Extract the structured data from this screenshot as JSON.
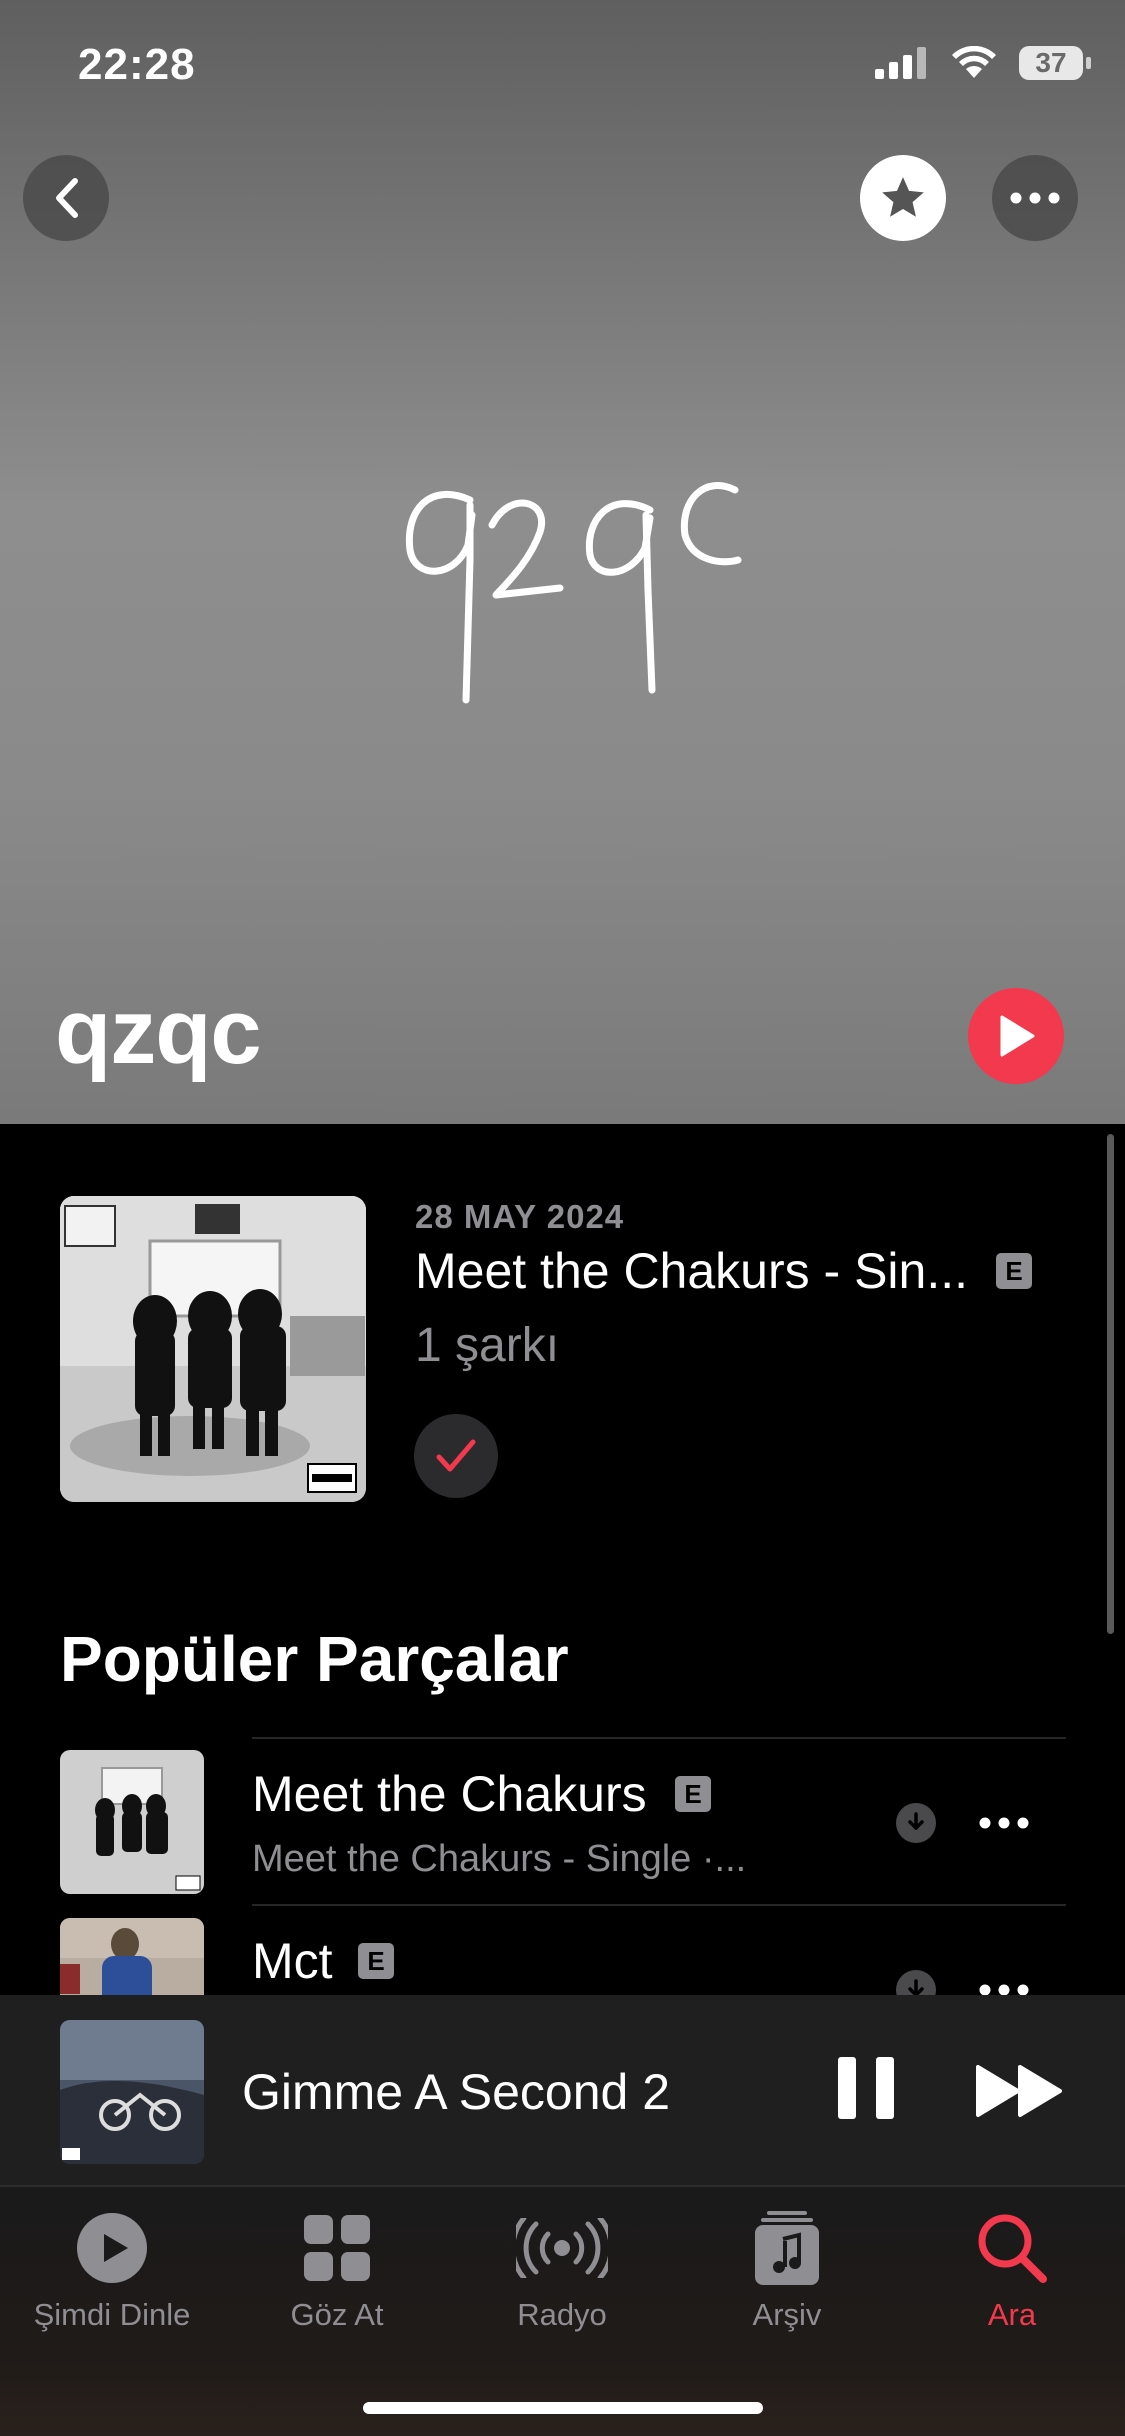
{
  "status_bar": {
    "time": "22:28",
    "battery": "37"
  },
  "artist": {
    "name": "qzqc",
    "logo_text": "qzqc"
  },
  "latest_release": {
    "date": "28 MAY 2024",
    "title": "Meet the Chakurs - Sin...",
    "explicit": "E",
    "count": "1 şarkı"
  },
  "popular": {
    "title": "Popüler Parçalar",
    "tracks": [
      {
        "title": "Meet the Chakurs",
        "explicit": "E",
        "subtitle": "Meet the Chakurs - Single ·..."
      },
      {
        "title": "Mct",
        "explicit": "E",
        "subtitle": ""
      }
    ]
  },
  "now_playing": {
    "title": "Gimme A Second 2"
  },
  "tabs": [
    {
      "label": "Şimdi Dinle",
      "icon": "play-circle-icon"
    },
    {
      "label": "Göz At",
      "icon": "grid-icon"
    },
    {
      "label": "Radyo",
      "icon": "radio-icon"
    },
    {
      "label": "Arşiv",
      "icon": "library-icon"
    },
    {
      "label": "Ara",
      "icon": "search-icon"
    }
  ],
  "colors": {
    "accent": "#f2394e",
    "secondary_text": "#8e8e93"
  }
}
